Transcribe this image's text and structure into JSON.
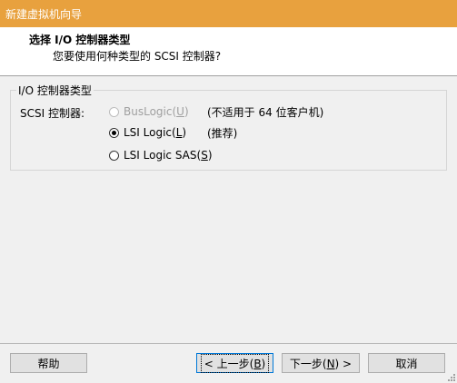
{
  "window": {
    "title": "新建虚拟机向导"
  },
  "header": {
    "title": "选择 I/O 控制器类型",
    "subtitle": "您要使用何种类型的 SCSI 控制器?"
  },
  "group": {
    "legend": "I/O 控制器类型",
    "field_label": "SCSI 控制器:",
    "options": [
      {
        "label": "BusLogic(",
        "mnemonic": "U",
        "suffix": ")",
        "note": "(不适用于 64 位客户机)",
        "state": "disabled",
        "checked": false
      },
      {
        "label": "LSI Logic(",
        "mnemonic": "L",
        "suffix": ")",
        "note": "(推荐)",
        "state": "enabled",
        "checked": true
      },
      {
        "label": "LSI Logic SAS(",
        "mnemonic": "S",
        "suffix": ")",
        "note": "",
        "state": "enabled",
        "checked": false
      }
    ]
  },
  "footer": {
    "help": "帮助",
    "back": {
      "prefix": "< 上一步(",
      "mnemonic": "B",
      "suffix": ")"
    },
    "next": {
      "prefix": "下一步(",
      "mnemonic": "N",
      "suffix": ") >"
    },
    "cancel": "取消"
  },
  "colors": {
    "titlebar": "#e8a13e",
    "focus_border": "#0078d7"
  }
}
